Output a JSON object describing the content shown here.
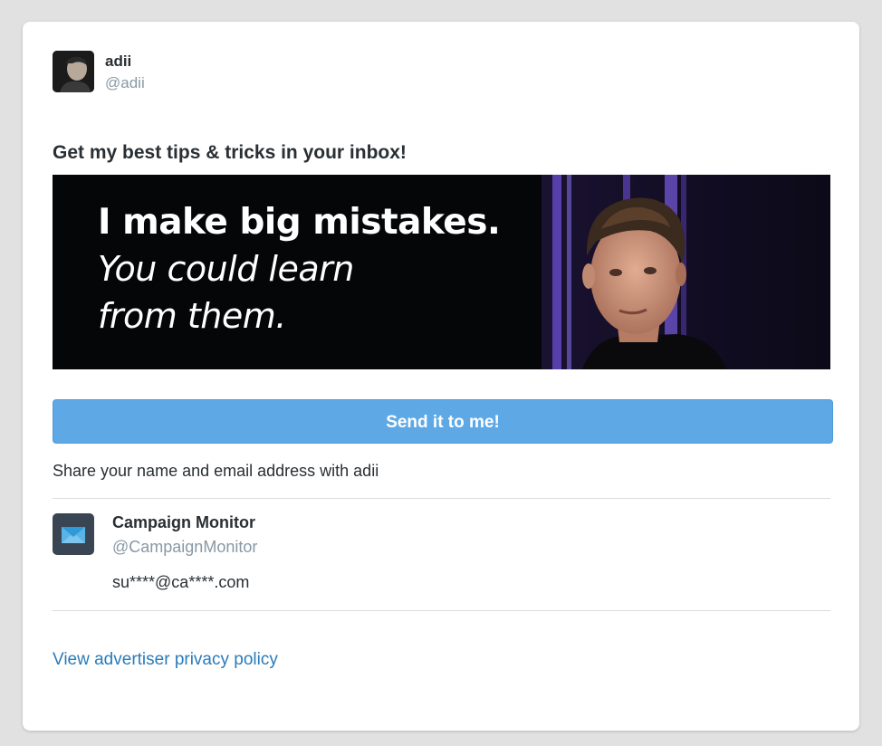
{
  "author": {
    "name": "adii",
    "handle": "@adii",
    "avatar_icon": "user-photo-icon"
  },
  "card": {
    "headline": "Get my best tips & tricks in your inbox!",
    "banner": {
      "line1": "I make big mistakes.",
      "line2": "You could learn",
      "line3": "from them."
    },
    "cta_label": "Send it to me!",
    "share_note": "Share your name and email address with adii"
  },
  "advertiser": {
    "name": "Campaign Monitor",
    "handle": "@CampaignMonitor",
    "email": "su****@ca****.com",
    "icon": "envelope-icon"
  },
  "footer": {
    "privacy_link": "View advertiser privacy policy"
  },
  "colors": {
    "background": "#e1e1e1",
    "card": "#ffffff",
    "cta": "#5ea9e5",
    "link": "#2b7bb9",
    "muted_text": "#8899a6",
    "primary_text": "#292f33"
  }
}
